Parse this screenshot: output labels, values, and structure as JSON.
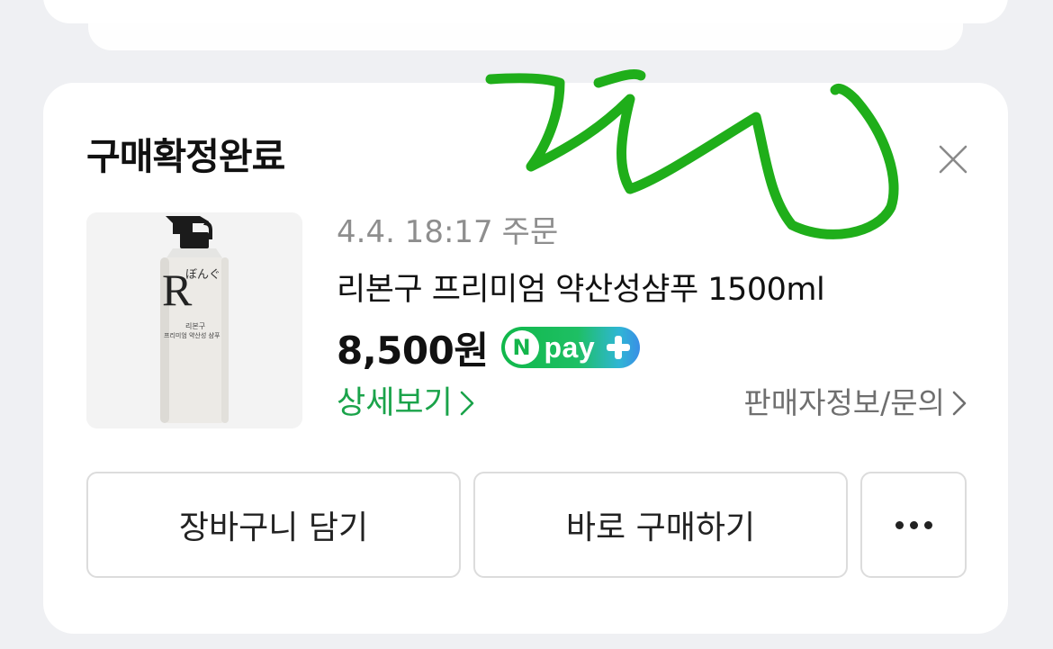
{
  "card": {
    "status_title": "구매확정완료",
    "order_date": "4.4. 18:17",
    "order_label": "주문",
    "product_name": "리본구 프리미엄 약산성샴푸 1500ml",
    "price": "8,500원",
    "payment_badge": {
      "logo_letter": "N",
      "word": "pay",
      "icon": "plus-icon",
      "colors": [
        "#10b84a",
        "#3a8ee6"
      ]
    },
    "detail_link": "상세보기",
    "seller_link": "판매자정보/문의"
  },
  "product_image": {
    "brand_letter": "R",
    "brand_script": "ぼんぐ",
    "label_line_1": "리본구",
    "label_line_2": "프리미엄 약산성 샴푸"
  },
  "actions": {
    "add_to_cart": "장바구니 담기",
    "buy_now": "바로 구매하기",
    "more_icon": "more-dots-icon"
  },
  "icons": {
    "close": "close-icon",
    "chevron": "chevron-right-icon"
  },
  "colors": {
    "background": "#eff0f3",
    "accent_green": "#1aa34a",
    "scribble_green": "#1fae1a",
    "muted_text": "#8e8e8e"
  }
}
